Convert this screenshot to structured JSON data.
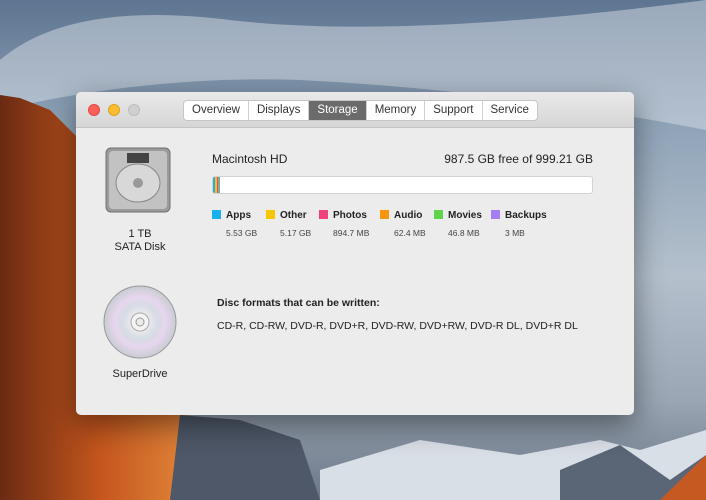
{
  "window": {
    "tabs": [
      "Overview",
      "Displays",
      "Storage",
      "Memory",
      "Support",
      "Service"
    ],
    "active_tab": "Storage"
  },
  "disk": {
    "name": "Macintosh HD",
    "free_text": "987.5 GB free of 999.21 GB",
    "size": "1 TB",
    "type": "SATA Disk",
    "used_fraction": 0.0117
  },
  "legend": [
    {
      "label": "Apps",
      "value": "5.53 GB",
      "color": "#1ab0f0",
      "gb": 5.53
    },
    {
      "label": "Other",
      "value": "5.17 GB",
      "color": "#f7c600",
      "gb": 5.17
    },
    {
      "label": "Photos",
      "value": "894.7 MB",
      "color": "#f2407a",
      "gb": 0.8947
    },
    {
      "label": "Audio",
      "value": "62.4 MB",
      "color": "#f7960e",
      "gb": 0.0624
    },
    {
      "label": "Movies",
      "value": "46.8 MB",
      "color": "#5fd34a",
      "gb": 0.0468
    },
    {
      "label": "Backups",
      "value": "3 MB",
      "color": "#a57df5",
      "gb": 0.003
    }
  ],
  "drive": {
    "name": "SuperDrive",
    "formats_heading": "Disc formats that can be written:",
    "formats": "CD-R, CD-RW, DVD-R, DVD+R, DVD-RW, DVD+RW, DVD-R DL, DVD+R DL"
  }
}
